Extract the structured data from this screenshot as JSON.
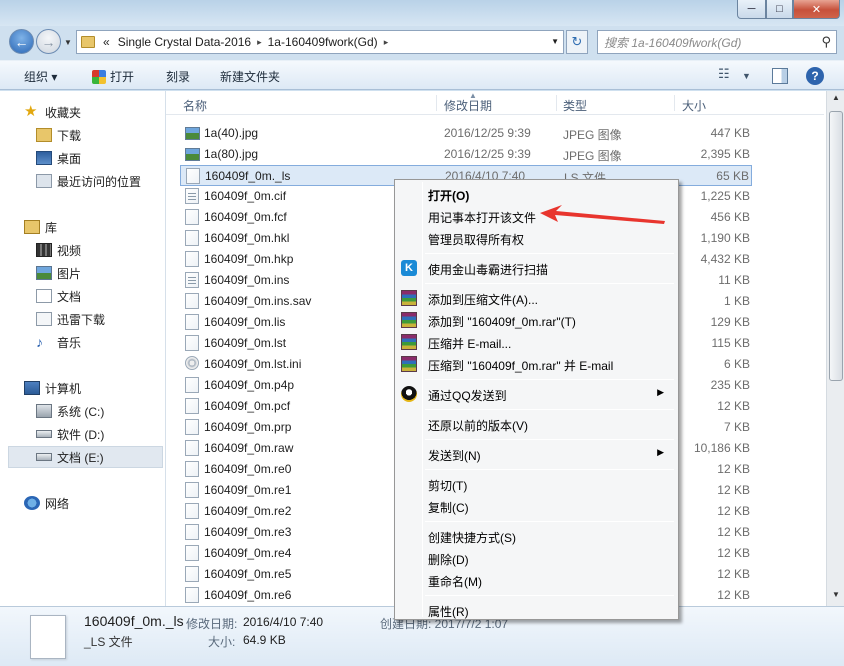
{
  "window": {
    "controls": {
      "minimize": "─",
      "maximize": "□",
      "close": "✕"
    }
  },
  "nav": {
    "back_glyph": "←",
    "forward_glyph": "→",
    "address": {
      "overflow": "«",
      "segments": [
        "Single Crystal Data-2016",
        "1a-160409fwork(Gd)"
      ],
      "separator": "▸"
    },
    "refresh_glyph": "↻",
    "search_placeholder": "搜索 1a-160409fwork(Gd)"
  },
  "toolbar": {
    "organize": "组织 ▾",
    "open": "打开",
    "burn": "刻录",
    "new_folder": "新建文件夹"
  },
  "sidebar": {
    "favorites": "收藏夹",
    "downloads": "下载",
    "desktop": "桌面",
    "recent": "最近访问的位置",
    "libraries": "库",
    "videos": "视频",
    "pictures": "图片",
    "documents": "文档",
    "xunlei": "迅雷下载",
    "music": "音乐",
    "computer": "计算机",
    "drive_c": "系统 (C:)",
    "drive_d": "软件 (D:)",
    "drive_e": "文档 (E:)",
    "network": "网络"
  },
  "columns": {
    "name": "名称",
    "date": "修改日期",
    "type": "类型",
    "size": "大小"
  },
  "files": [
    {
      "name": "1a(40).jpg",
      "date": "2016/12/25 9:39",
      "type": "JPEG 图像",
      "size": "447 KB",
      "icon": "image"
    },
    {
      "name": "1a(80).jpg",
      "date": "2016/12/25 9:39",
      "type": "JPEG 图像",
      "size": "2,395 KB",
      "icon": "image"
    },
    {
      "name": "160409f_0m._ls",
      "date": "2016/4/10 7:40",
      "type": "LS 文件",
      "size": "65 KB",
      "icon": "file"
    },
    {
      "name": "160409f_0m.cif",
      "date": "",
      "type": "",
      "size": "1,225 KB",
      "icon": "text"
    },
    {
      "name": "160409f_0m.fcf",
      "date": "",
      "type": "",
      "size": "456 KB",
      "icon": "file"
    },
    {
      "name": "160409f_0m.hkl",
      "date": "",
      "type": "",
      "size": "1,190 KB",
      "icon": "file"
    },
    {
      "name": "160409f_0m.hkp",
      "date": "",
      "type": "",
      "size": "4,432 KB",
      "icon": "file"
    },
    {
      "name": "160409f_0m.ins",
      "date": "",
      "type": "",
      "size": "11 KB",
      "icon": "text"
    },
    {
      "name": "160409f_0m.ins.sav",
      "date": "",
      "type": "",
      "size": "1 KB",
      "icon": "file"
    },
    {
      "name": "160409f_0m.lis",
      "date": "",
      "type": "",
      "size": "129 KB",
      "icon": "file"
    },
    {
      "name": "160409f_0m.lst",
      "date": "",
      "type": "",
      "size": "115 KB",
      "icon": "file"
    },
    {
      "name": "160409f_0m.lst.ini",
      "date": "",
      "type": "",
      "size": "6 KB",
      "icon": "ini"
    },
    {
      "name": "160409f_0m.p4p",
      "date": "",
      "type": "",
      "size": "235 KB",
      "icon": "file"
    },
    {
      "name": "160409f_0m.pcf",
      "date": "",
      "type": "",
      "size": "12 KB",
      "icon": "file"
    },
    {
      "name": "160409f_0m.prp",
      "date": "",
      "type": "",
      "size": "7 KB",
      "icon": "file"
    },
    {
      "name": "160409f_0m.raw",
      "date": "",
      "type": "",
      "size": "10,186 KB",
      "icon": "file"
    },
    {
      "name": "160409f_0m.re0",
      "date": "",
      "type": "",
      "size": "12 KB",
      "icon": "file"
    },
    {
      "name": "160409f_0m.re1",
      "date": "",
      "type": "",
      "size": "12 KB",
      "icon": "file"
    },
    {
      "name": "160409f_0m.re2",
      "date": "",
      "type": "",
      "size": "12 KB",
      "icon": "file"
    },
    {
      "name": "160409f_0m.re3",
      "date": "",
      "type": "",
      "size": "12 KB",
      "icon": "file"
    },
    {
      "name": "160409f_0m.re4",
      "date": "",
      "type": "",
      "size": "12 KB",
      "icon": "file"
    },
    {
      "name": "160409f_0m.re5",
      "date": "",
      "type": "",
      "size": "12 KB",
      "icon": "file"
    },
    {
      "name": "160409f_0m.re6",
      "date": "",
      "type": "",
      "size": "12 KB",
      "icon": "file"
    }
  ],
  "selected_index": 2,
  "context_menu": {
    "items": [
      {
        "label": "打开(O)",
        "bold": true,
        "icon": ""
      },
      {
        "label": "用记事本打开该文件",
        "icon": ""
      },
      {
        "label": "管理员取得所有权",
        "icon": ""
      },
      {
        "sep": true
      },
      {
        "label": "使用金山毒霸进行扫描",
        "icon": "kingsoft-icon"
      },
      {
        "sep": true
      },
      {
        "label": "添加到压缩文件(A)...",
        "icon": "winrar-icon"
      },
      {
        "label": "添加到 \"160409f_0m.rar\"(T)",
        "icon": "winrar-icon"
      },
      {
        "label": "压缩并 E-mail...",
        "icon": "winrar-icon"
      },
      {
        "label": "压缩到 \"160409f_0m.rar\" 并 E-mail",
        "icon": "winrar-icon"
      },
      {
        "sep": true
      },
      {
        "label": "通过QQ发送到",
        "icon": "qq-icon",
        "submenu": true
      },
      {
        "sep": true
      },
      {
        "label": "还原以前的版本(V)",
        "icon": ""
      },
      {
        "sep": true
      },
      {
        "label": "发送到(N)",
        "icon": "",
        "submenu": true
      },
      {
        "sep": true
      },
      {
        "label": "剪切(T)",
        "icon": ""
      },
      {
        "label": "复制(C)",
        "icon": ""
      },
      {
        "sep": true
      },
      {
        "label": "创建快捷方式(S)",
        "icon": ""
      },
      {
        "label": "删除(D)",
        "icon": ""
      },
      {
        "label": "重命名(M)",
        "icon": ""
      },
      {
        "sep": true
      },
      {
        "label": "属性(R)",
        "icon": ""
      }
    ],
    "submenu_glyph": "▶"
  },
  "details_pane": {
    "filename": "160409f_0m._ls",
    "filetype": "_LS 文件",
    "modified_label": "修改日期:",
    "modified_value": "2016/4/10 7:40",
    "size_label": "大小:",
    "size_value": "64.9 KB",
    "created_partial": "创建日期: 2017/7/2 1:07"
  },
  "annotation": {
    "arrow_color": "#e8352e"
  }
}
